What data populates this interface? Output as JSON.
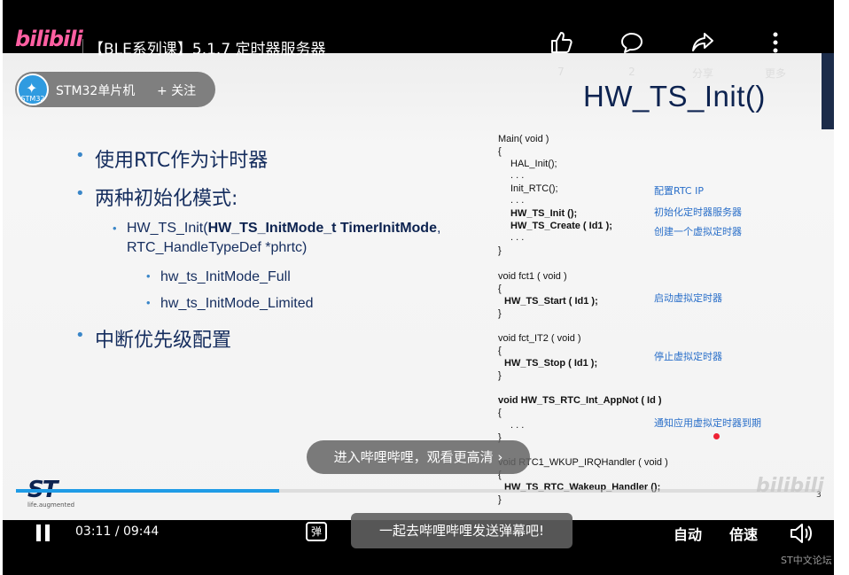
{
  "topbar": {
    "logo": "bilibili",
    "title": "【BLE系列课】5.1.7 定时器服务器",
    "like_count": "7",
    "comment_count": "2",
    "share_label": "分享",
    "more_label": "更多"
  },
  "uploader": {
    "avatar_text": "STM32",
    "name": "STM32单片机",
    "follow_label": "+ 关注"
  },
  "slide": {
    "title": "HW_TS_Init()",
    "bullets": {
      "b1": "使用RTC作为计时器",
      "b2": "两种初始化模式:",
      "b3_prefix": "HW_TS_Init(",
      "b3_bold": "HW_TS_InitMode_t TimerInitMode",
      "b3_suffix": ", RTC_HandleTypeDef *phrtc)",
      "sb1": "hw_ts_InitMode_Full",
      "sb2": "hw_ts_InitMode_Limited",
      "b4": "中断优先级配置"
    },
    "code": {
      "l1": "Main( void )",
      "l2": "{",
      "l3": "HAL_Init();",
      "l4": ". . .",
      "l5": "Init_RTC();",
      "l6": ". . .",
      "l7": "HW_TS_Init ();",
      "l8": "HW_TS_Create ( Id1 );",
      "l9": ". . .",
      "l10": "}",
      "l11": "void fct1 ( void )",
      "l12": "{",
      "l13": "HW_TS_Start ( Id1 );",
      "l14": "}",
      "l15": "void fct_IT2 ( void )",
      "l16": "{",
      "l17": "HW_TS_Stop ( Id1 );",
      "l18": "}",
      "l19": "void HW_TS_RTC_Int_AppNot ( Id )",
      "l20": "{",
      "l21": ". . .",
      "l22": "}",
      "l23": "void RTC1_WKUP_IRQHandler ( void )",
      "l24": "{",
      "l25": "HW_TS_RTC_Wakeup_Handler ();",
      "l26": "}"
    },
    "notes": {
      "n1": "配置RTC IP",
      "n2": "初始化定时器服务器",
      "n3": "创建一个虚拟定时器",
      "n4": "启动虚拟定时器",
      "n5": "停止虚拟定时器",
      "n6": "通知应用虚拟定时器到期"
    },
    "st_tagline": "life.augmented",
    "page_number": "3",
    "watermark": "bilibili"
  },
  "hd_prompt": "进入哔哩哔哩，观看更高清 ›",
  "controls": {
    "current_time": "03:11",
    "time_sep": "/",
    "duration": "09:44",
    "progress_fraction": 0.327,
    "danmaku_icon_text": "弹",
    "danmaku_placeholder": "一起去哔哩哔哩发送弹幕吧!",
    "auto_label": "自动",
    "speed_label": "倍速"
  },
  "forum_text": "ST中文论坛",
  "colors": {
    "accent_blue": "#1f9be6",
    "bili_pink": "#ff5fa2",
    "slide_navy": "#0d2350",
    "note_blue": "#2a6fc9"
  }
}
